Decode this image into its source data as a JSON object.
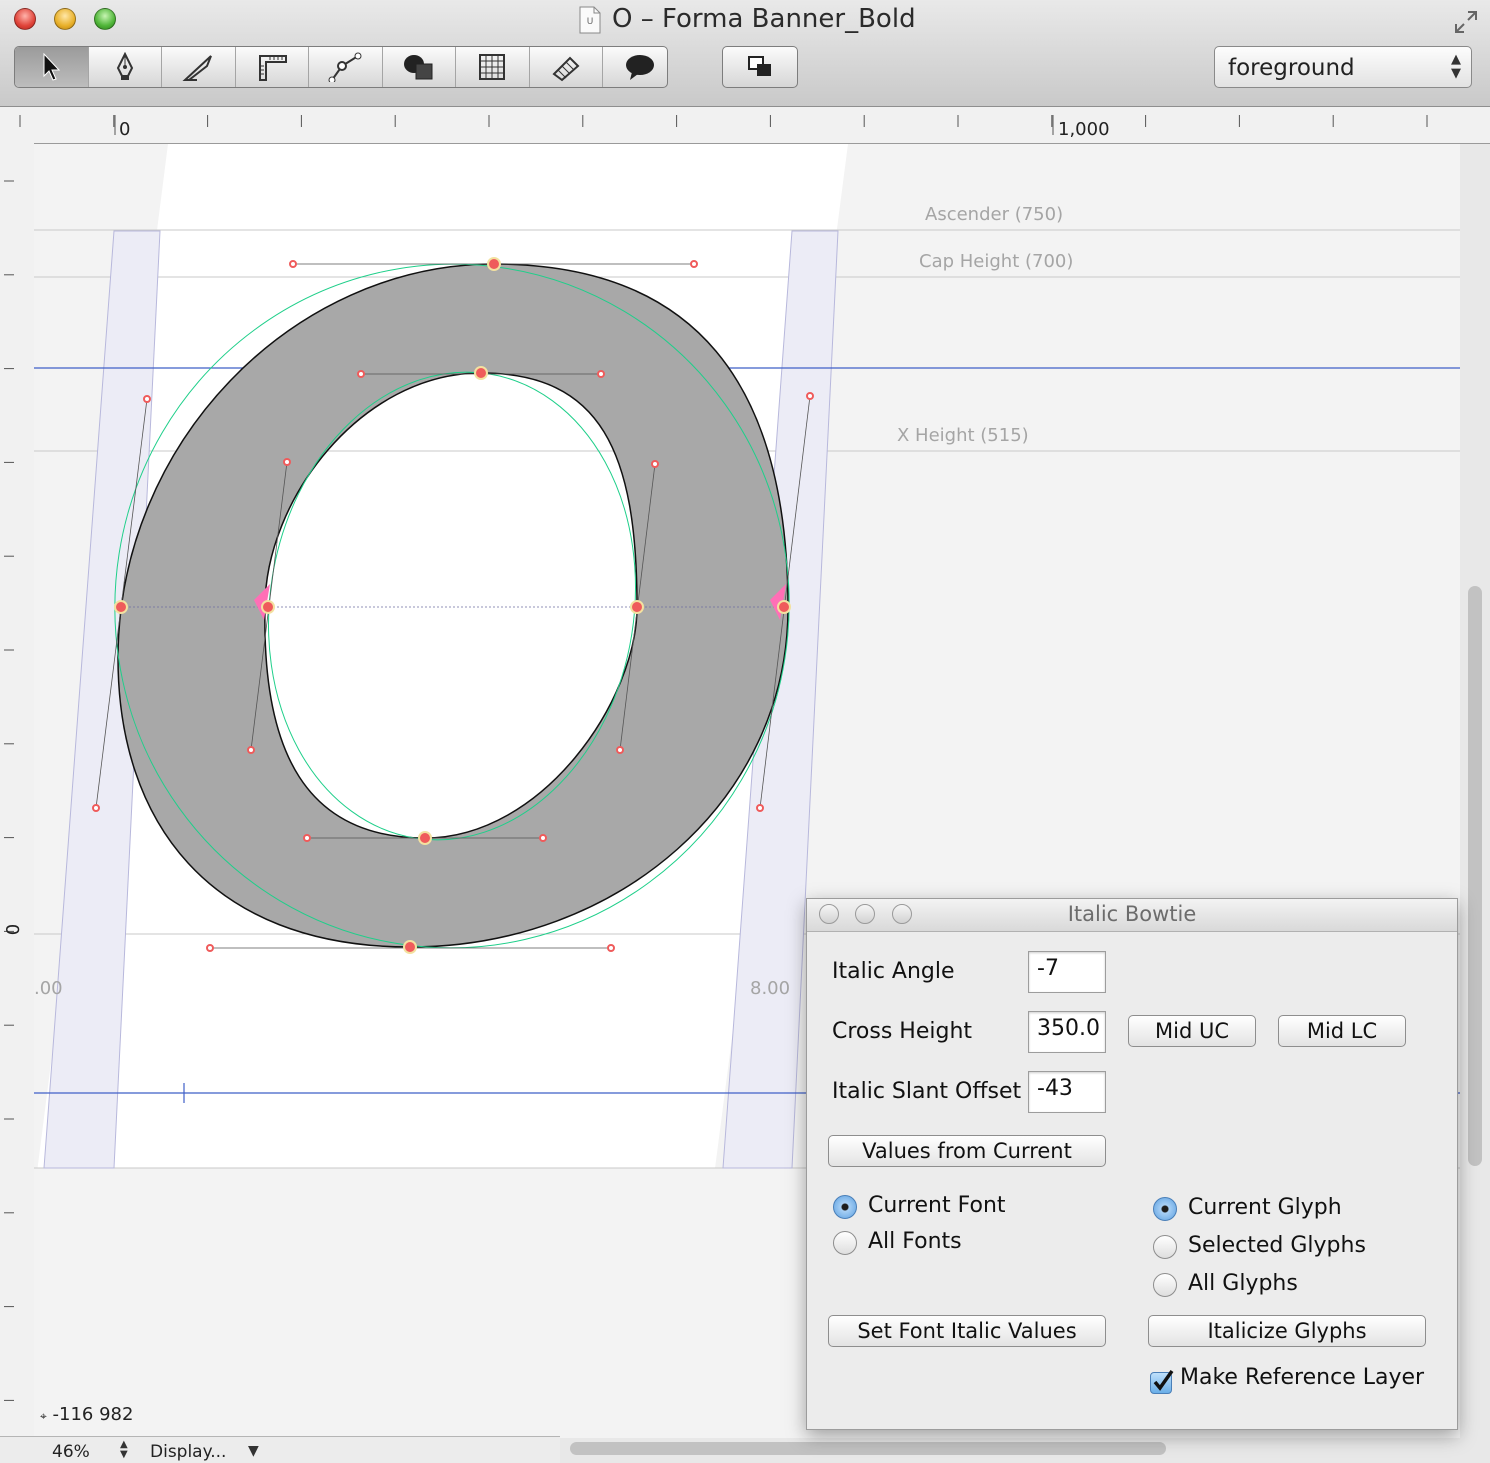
{
  "window": {
    "title": "O – Forma Banner_Bold",
    "layer_select": "foreground",
    "tools": [
      "select-tool",
      "pen-tool",
      "knife-tool",
      "measure-tool",
      "bender-tool",
      "shapes-tool",
      "grid-tool",
      "eraser-tool",
      "comment-tool"
    ]
  },
  "rulers": {
    "h_zero": "0",
    "h_thousand": "1,000",
    "v_zero": "0"
  },
  "canvas": {
    "metrics": {
      "ascender": "Ascender (750)",
      "cap_height": "Cap Height (700)",
      "x_height": "X Height (515)"
    },
    "left_margin_label": ".00",
    "right_margin_label": "8.00",
    "colors": {
      "glyph_fill": "#a8a8a8",
      "point": "#ef5b5b",
      "guide": "#3f5fc8",
      "bowtie_outline": "#1fcf8a"
    }
  },
  "status": {
    "coords": "-116 982",
    "zoom": "46%",
    "display": "Display..."
  },
  "panel": {
    "title": "Italic Bowtie",
    "italic_angle_label": "Italic Angle",
    "italic_angle": "-7",
    "cross_height_label": "Cross Height",
    "cross_height": "350.0",
    "mid_uc": "Mid UC",
    "mid_lc": "Mid LC",
    "slant_offset_label": "Italic Slant Offset",
    "slant_offset": "-43",
    "values_from_current": "Values from Current",
    "font_scope": {
      "current_font": "Current Font",
      "all_fonts": "All Fonts",
      "selected": "Current Font"
    },
    "glyph_scope": {
      "current_glyph": "Current Glyph",
      "selected_glyphs": "Selected Glyphs",
      "all_glyphs": "All Glyphs",
      "selected": "Current Glyph"
    },
    "set_font_italic_values": "Set Font Italic Values",
    "italicize_glyphs": "Italicize Glyphs",
    "make_reference_layer": "Make Reference Layer",
    "make_reference_layer_checked": true
  }
}
